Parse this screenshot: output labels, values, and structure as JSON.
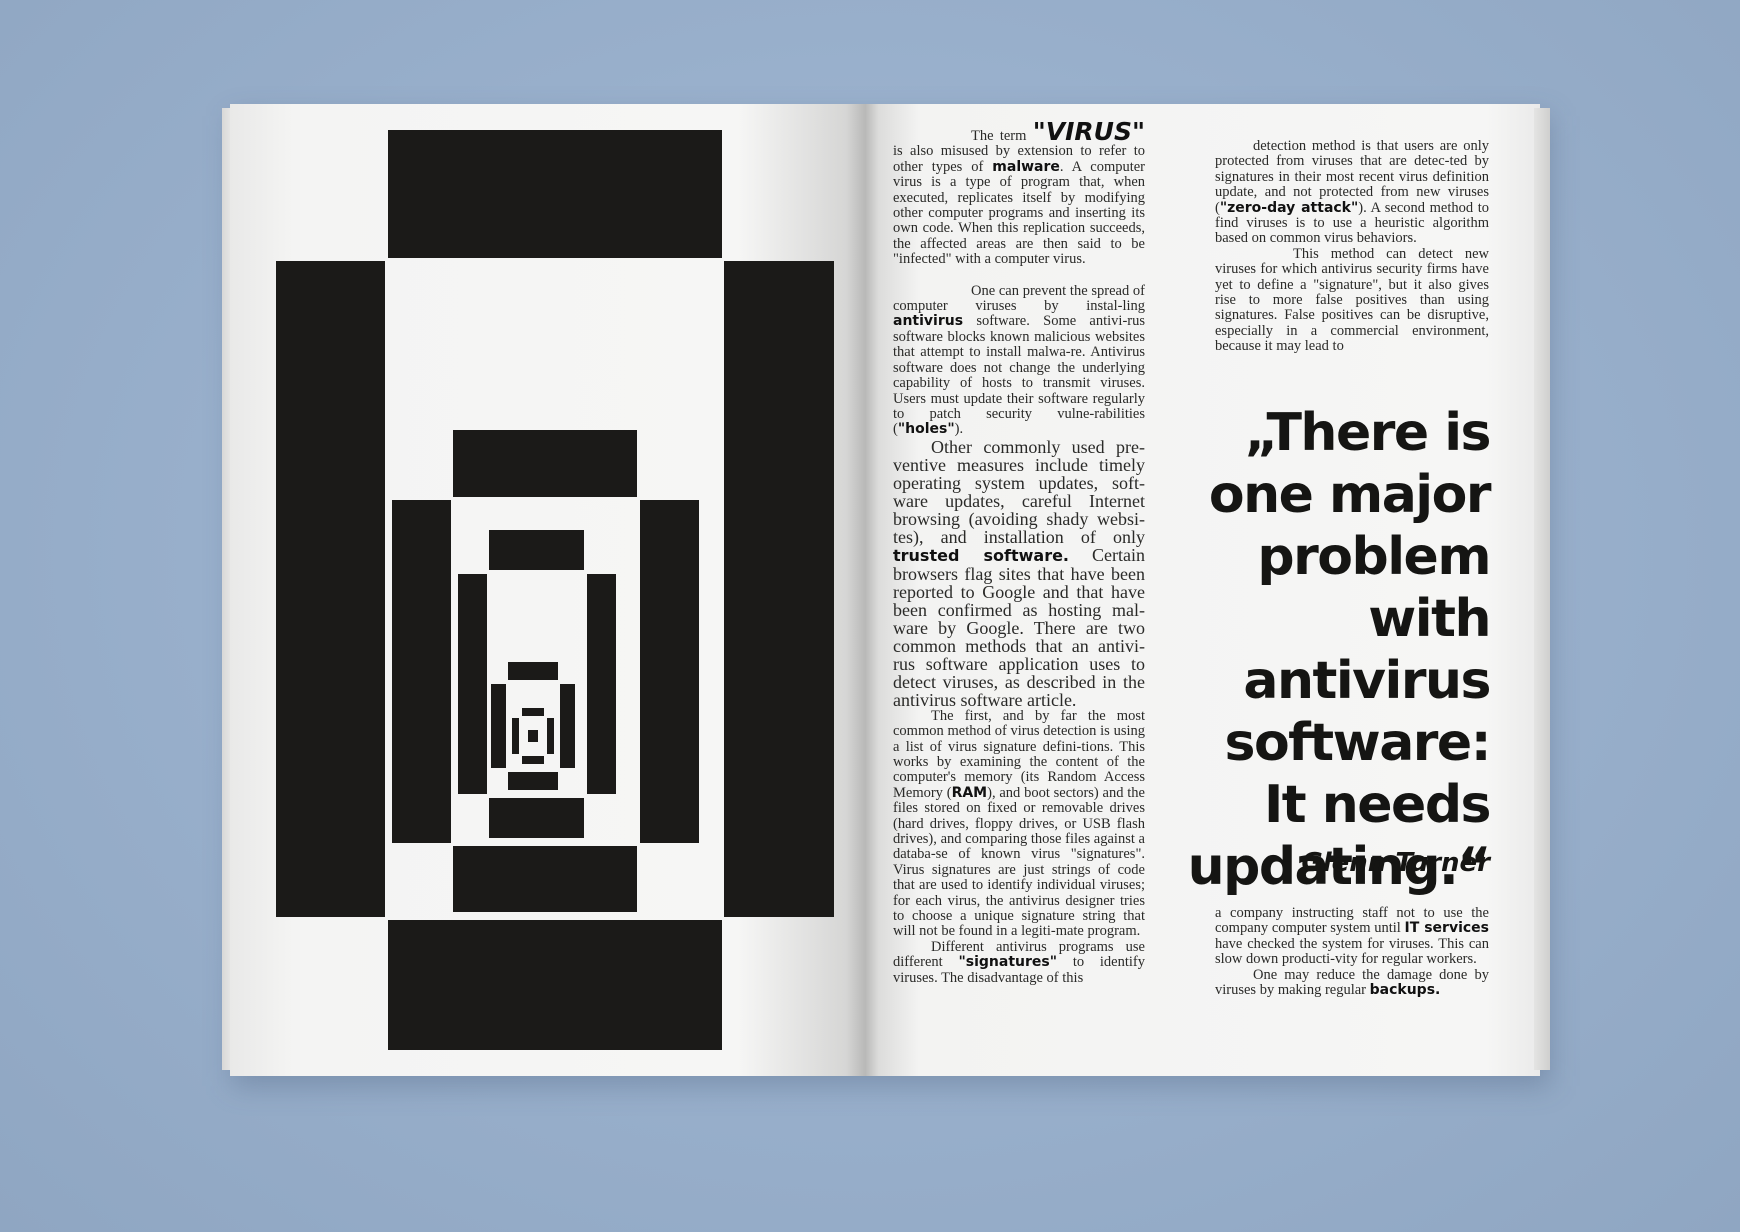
{
  "col1": {
    "p1_lead": "The term",
    "p1_kw": "\"VIRUS\"",
    "p1_a": "is also misused by extension to refer to other types of",
    "p1_kw2": "malware",
    "p1_b": ". A computer virus is a type of program that, when executed, replicates itself by modifying other computer programs and inserting its own code. When this replication succeeds, the affected areas are then said to be \"infected\" with a computer virus.",
    "p2_a": "One can prevent the spread of computer viruses by instal-ling",
    "p2_kw": "antivirus",
    "p2_b": "software. Some antivi-rus software blocks known malicious websites that attempt to install malwa-re. Antivirus software does not change the underlying capability of hosts to transmit viruses. Users must update their software regularly to patch security vulne-rabilities (",
    "p2_kw2": "\"holes\"",
    "p2_c": ").",
    "p3_a": "Other commonly used pre-ventive measures include timely operating system updates, soft-ware updates, careful Internet browsing (avoiding shady websi-tes), and installation of only",
    "p3_kw": "trusted software.",
    "p3_b": "Certain browsers flag sites that have been reported to Google and that have been confirmed as hosting mal-ware by Google. There are two common methods that an antivi-rus software application uses to detect viruses, as described in the antivirus software article.",
    "p4_a": "The first, and by far the most common method of virus detection is using a list of virus signature defini-tions. This works by examining the content of the computer's memory (its Random Access Memory (",
    "p4_kw": "RAM",
    "p4_b": "), and boot sectors) and the files stored on fixed or removable drives (hard drives, floppy drives, or USB flash drives), and comparing those files against a databa-se of known virus \"signatures\". Virus signatures are just strings of code that are used to identify individual viruses; for each virus, the antivirus designer tries to choose a unique signature string that will not be found in a legiti-mate program.",
    "p5_a": "Different antivirus programs use different",
    "p5_kw": "\"signatures\"",
    "p5_b": "to identify viruses. The disadvantage of this"
  },
  "col2": {
    "p1_a": "detection method is that users are only protected from viruses that are detec-ted by signatures in their most recent virus definition update, and not protected from new viruses (",
    "p1_kw": "\"zero-day attack\"",
    "p1_b": "). A second method to find viruses is to use a heuristic algorithm based on common virus behaviors.",
    "p2": "This method can detect new viruses for which antivirus security firms have yet to define a \"signature\", but it also gives rise to more false positives than using signatures. False positives can be disruptive, especially in a commercial environment, because it may lead to",
    "p3_a": "a company instructing staff not to use the company computer system until",
    "p3_kw": "IT services",
    "p3_b": "have checked the system for viruses. This can slow down producti-vity for regular workers.",
    "p4_a": "One may reduce the damage done by viruses by making regular",
    "p4_kw": "backups."
  },
  "pullquote": {
    "line1": "„There is",
    "line2": "one major",
    "line3": "problem with",
    "line4": "antivirus",
    "line5": "software:",
    "line6": "It needs",
    "line7": "updating.“",
    "author": "- Glenn Turner"
  },
  "colors": {
    "background": "#99b0cb",
    "ink": "#1b1a18",
    "paper": "#f6f6f5"
  }
}
